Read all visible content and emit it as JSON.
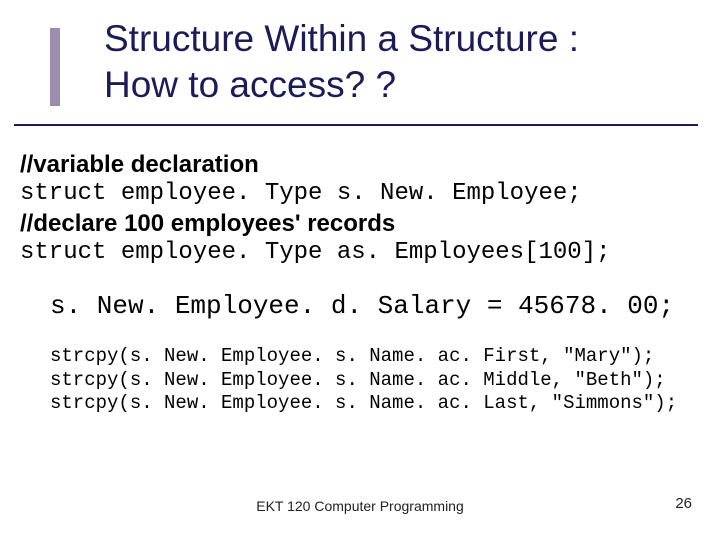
{
  "title": {
    "line1": "Structure Within a Structure :",
    "line2": "How to access? ?"
  },
  "code": {
    "comment1": "//variable declaration",
    "decl1": "struct employee. Type s. New. Employee;",
    "comment2": "//declare 100 employees' records",
    "decl2": "struct employee. Type as. Employees[100];",
    "assign": "s. New. Employee. d. Salary = 45678. 00;",
    "strcpy1": "strcpy(s. New. Employee. s. Name. ac. First, \"Mary\");",
    "strcpy2": "strcpy(s. New. Employee. s. Name. ac. Middle, \"Beth\");",
    "strcpy3": "strcpy(s. New. Employee. s. Name. ac. Last, \"Simmons\");"
  },
  "footer": {
    "center": "EKT 120 Computer Programming",
    "page": "26"
  }
}
